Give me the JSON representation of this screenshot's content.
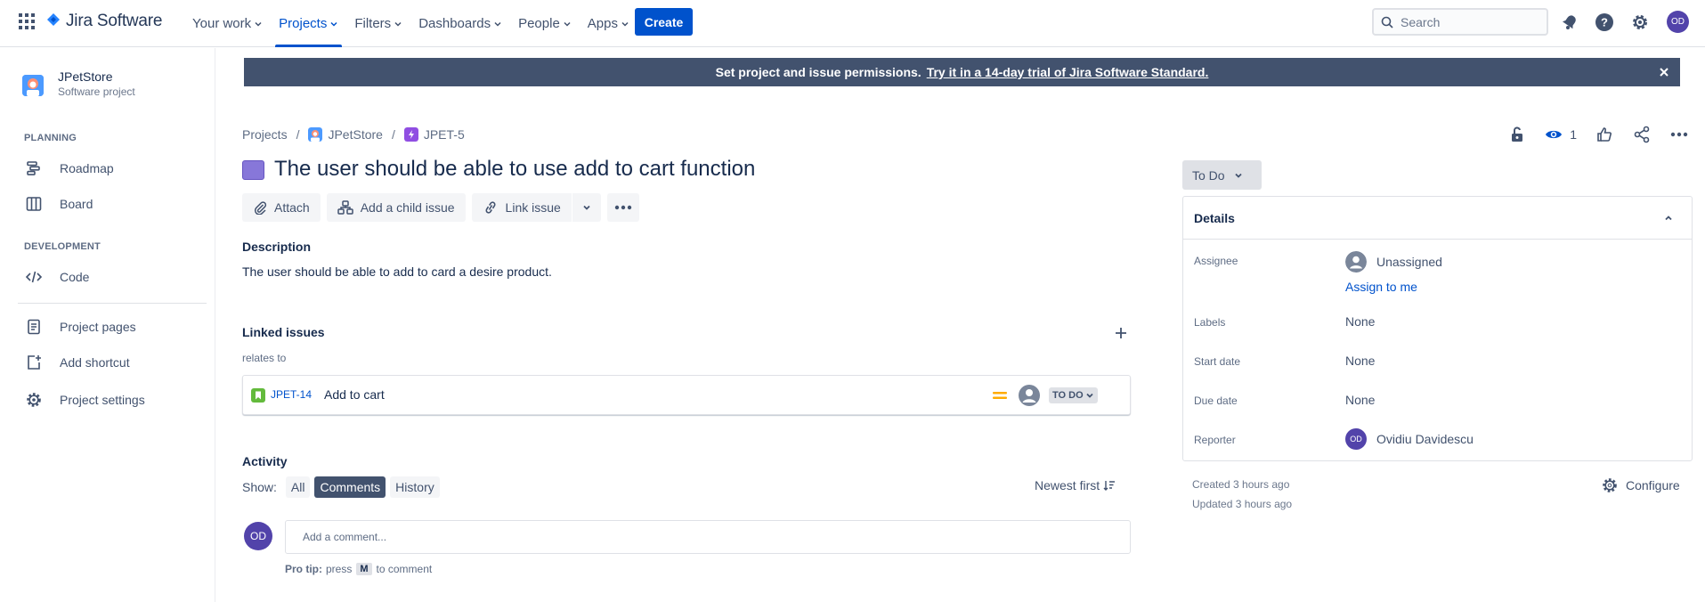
{
  "nav": {
    "app_name": "Jira Software",
    "items": [
      {
        "label": "Your work"
      },
      {
        "label": "Projects"
      },
      {
        "label": "Filters"
      },
      {
        "label": "Dashboards"
      },
      {
        "label": "People"
      },
      {
        "label": "Apps"
      }
    ],
    "create_label": "Create",
    "search_placeholder": "Search",
    "user_initials": "OD",
    "icons": [
      "app-switcher-icon",
      "jira-logo-icon",
      "notifications-icon",
      "help-icon",
      "settings-icon"
    ]
  },
  "sidebar": {
    "project_name": "JPetStore",
    "project_type": "Software project",
    "planning_heading": "PLANNING",
    "planning_items": [
      {
        "label": "Roadmap",
        "icon": "roadmap-icon"
      },
      {
        "label": "Board",
        "icon": "board-icon"
      }
    ],
    "development_heading": "DEVELOPMENT",
    "development_items": [
      {
        "label": "Code",
        "icon": "code-icon"
      }
    ],
    "footer_items": [
      {
        "label": "Project pages",
        "icon": "pages-icon"
      },
      {
        "label": "Add shortcut",
        "icon": "add-shortcut-icon"
      },
      {
        "label": "Project settings",
        "icon": "gear-icon"
      }
    ]
  },
  "banner": {
    "text": "Set project and issue permissions.",
    "link": "Try it in a 14-day trial of Jira Software Standard."
  },
  "breadcrumb": {
    "root": "Projects",
    "project": "JPetStore",
    "issue": "JPET-5"
  },
  "issue": {
    "title": "The user should be able to use add to cart function",
    "watch_count": "1",
    "toolbar": {
      "attach": "Attach",
      "add_child": "Add a child issue",
      "link_issue": "Link issue"
    },
    "description_label": "Description",
    "description": "The user should be able to add to card a desire product.",
    "linked_label": "Linked issues",
    "relation": "relates to",
    "linked": [
      {
        "key": "JPET-14",
        "summary": "Add to cart",
        "status": "TO DO",
        "priority": "medium"
      }
    ],
    "activity_label": "Activity",
    "show_label": "Show:",
    "filters": [
      "All",
      "Comments",
      "History"
    ],
    "active_filter": "Comments",
    "sort_label": "Newest first",
    "comment_placeholder": "Add a comment...",
    "protip_prefix": "Pro tip:",
    "protip_press": "press",
    "protip_key": "M",
    "protip_suffix": "to comment",
    "commenter_initials": "OD"
  },
  "panel": {
    "status": "To Do",
    "details_label": "Details",
    "fields": {
      "assignee_label": "Assignee",
      "assignee": "Unassigned",
      "assign_me": "Assign to me",
      "labels_label": "Labels",
      "labels": "None",
      "start_label": "Start date",
      "start": "None",
      "due_label": "Due date",
      "due": "None",
      "reporter_label": "Reporter",
      "reporter": "Ovidiu Davidescu",
      "reporter_initials": "OD"
    },
    "created": "Created 3 hours ago",
    "updated": "Updated 3 hours ago",
    "configure": "Configure"
  },
  "colors": {
    "brand": "#0052cc",
    "banner": "#42526e",
    "story_type": "#8777d9",
    "linked_type": "#63ba3c",
    "priority": "#ffab00",
    "avatar": "#5243aa"
  }
}
